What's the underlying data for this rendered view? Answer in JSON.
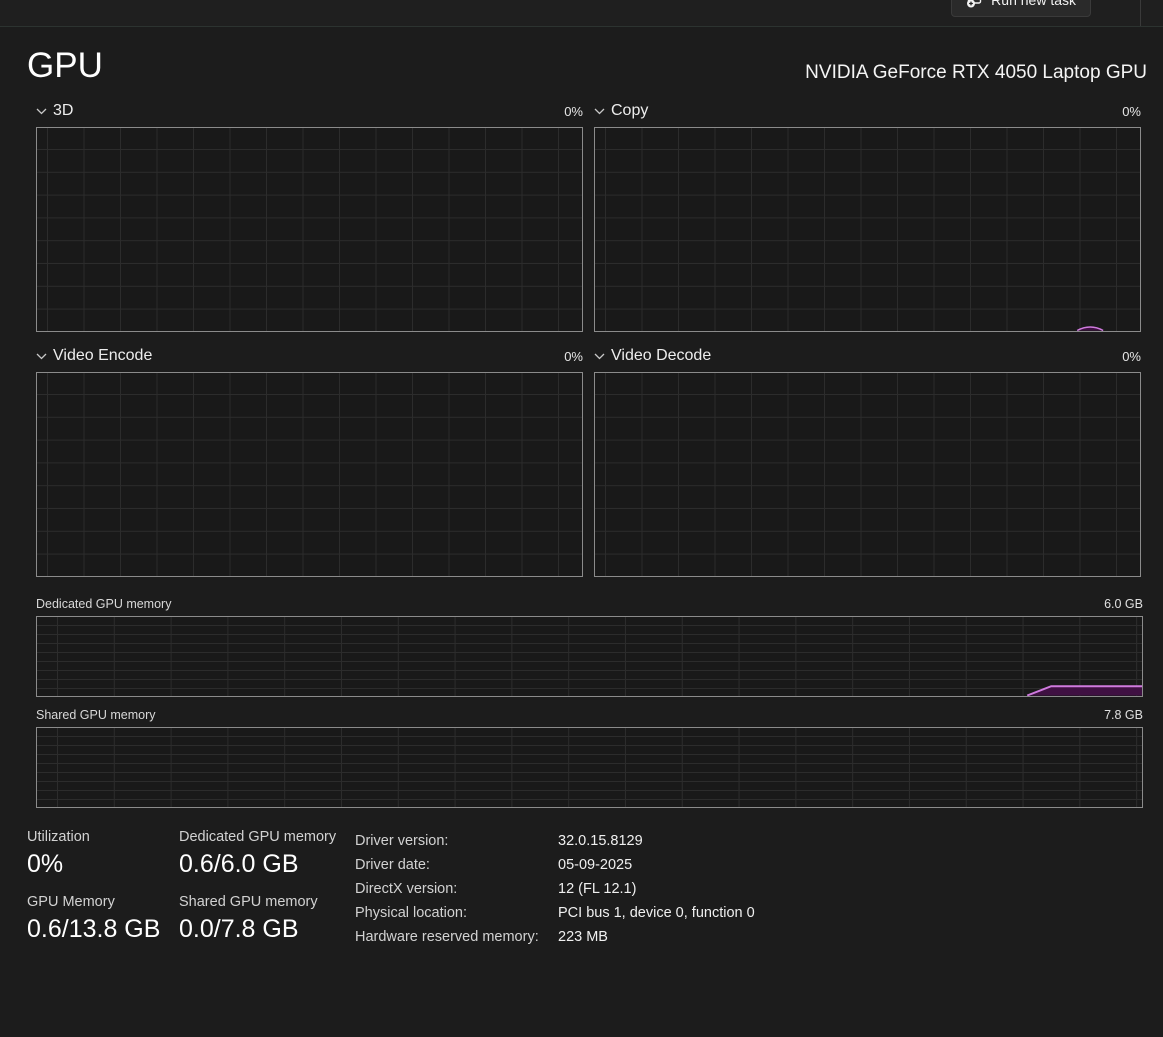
{
  "toolbar": {
    "run_new_task": "Run new task"
  },
  "header": {
    "title": "GPU",
    "gpu_name": "NVIDIA GeForce RTX 4050 Laptop GPU"
  },
  "engine_charts": [
    {
      "label": "3D",
      "utilization": "0%"
    },
    {
      "label": "Copy",
      "utilization": "0%"
    },
    {
      "label": "Video Encode",
      "utilization": "0%"
    },
    {
      "label": "Video Decode",
      "utilization": "0%"
    }
  ],
  "memory_charts": [
    {
      "label": "Dedicated GPU memory",
      "scale_max": "6.0 GB"
    },
    {
      "label": "Shared GPU memory",
      "scale_max": "7.8 GB"
    }
  ],
  "stats": {
    "utilization": {
      "label": "Utilization",
      "value": "0%"
    },
    "dedicated_memory": {
      "label": "Dedicated GPU memory",
      "value": "0.6/6.0 GB"
    },
    "gpu_memory": {
      "label": "GPU Memory",
      "value": "0.6/13.8 GB"
    },
    "shared_memory": {
      "label": "Shared GPU memory",
      "value": "0.0/7.8 GB"
    }
  },
  "details": [
    {
      "label": "Driver version:",
      "value": "32.0.15.8129"
    },
    {
      "label": "Driver date:",
      "value": "05-09-2025"
    },
    {
      "label": "DirectX version:",
      "value": "12 (FL 12.1)"
    },
    {
      "label": "Physical location:",
      "value": "PCI bus 1, device 0, function 0"
    },
    {
      "label": "Hardware reserved memory:",
      "value": "223 MB"
    }
  ],
  "colors": {
    "accent_purple_line": "#cf7ade",
    "accent_purple_fill": "#3f1042"
  },
  "chart_data": {
    "type": "area",
    "charts": [
      {
        "name": "3D",
        "unit": "%",
        "range": [
          0,
          100
        ],
        "current_value": 0,
        "trace": "flat at 0"
      },
      {
        "name": "Copy",
        "unit": "%",
        "range": [
          0,
          100
        ],
        "current_value": 0,
        "trace": "flat at 0 with tiny spike (~2%) near right edge"
      },
      {
        "name": "Video Encode",
        "unit": "%",
        "range": [
          0,
          100
        ],
        "current_value": 0,
        "trace": "flat at 0"
      },
      {
        "name": "Video Decode",
        "unit": "%",
        "range": [
          0,
          100
        ],
        "current_value": 0,
        "trace": "flat at 0"
      },
      {
        "name": "Dedicated GPU memory",
        "unit": "GB",
        "range": [
          0,
          6.0
        ],
        "current_value": 0.6,
        "trace": "0 until near right edge, ramps up to 0.6 and stays flat"
      },
      {
        "name": "Shared GPU memory",
        "unit": "GB",
        "range": [
          0,
          7.8
        ],
        "current_value": 0.0,
        "trace": "flat at 0"
      }
    ]
  }
}
